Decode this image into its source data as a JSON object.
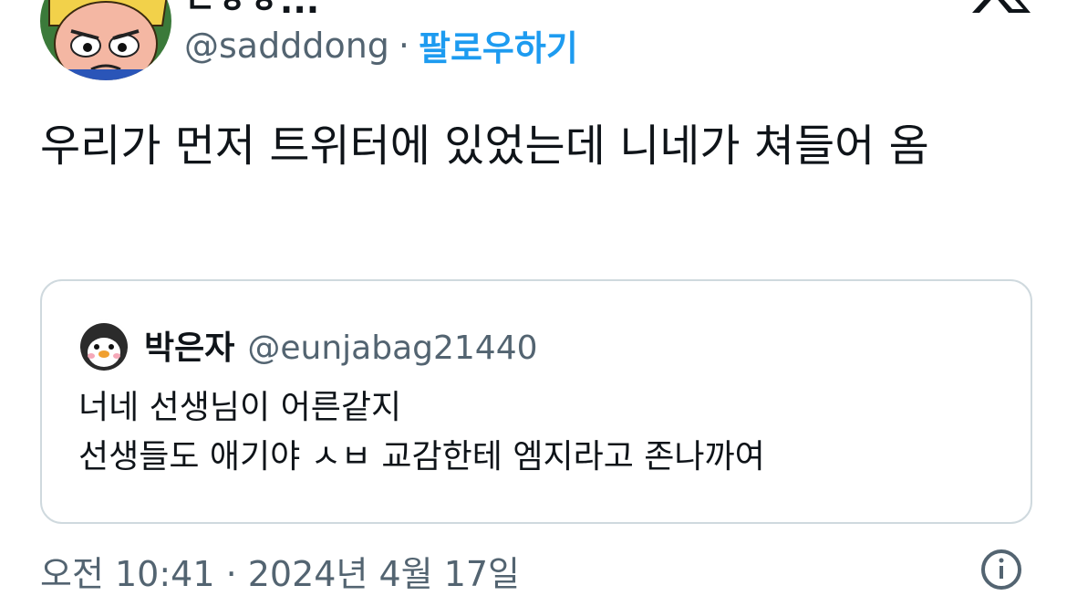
{
  "author": {
    "display_name": "ㄷㅎㅎ...",
    "handle": "@sadddong",
    "separator": "·",
    "follow_label": "팔로우하기"
  },
  "tweet": {
    "text": "우리가 먼저 트위터에 있었는데 니네가 쳐들어 옴"
  },
  "quoted": {
    "name": "박은자",
    "handle": "@eunjabag21440",
    "lines": [
      "너네 선생님이 어른같지",
      "선생들도 애기야 ㅅㅂ 교감한테 엠지라고 존나까여"
    ]
  },
  "footer": {
    "timestamp": "오전 10:41 · 2024년 4월 17일"
  },
  "icons": {
    "logo": "x-logo-icon",
    "info": "info-icon"
  },
  "colors": {
    "accent": "#1d9bf0",
    "secondary_text": "#536471",
    "border": "#cfd9de"
  }
}
